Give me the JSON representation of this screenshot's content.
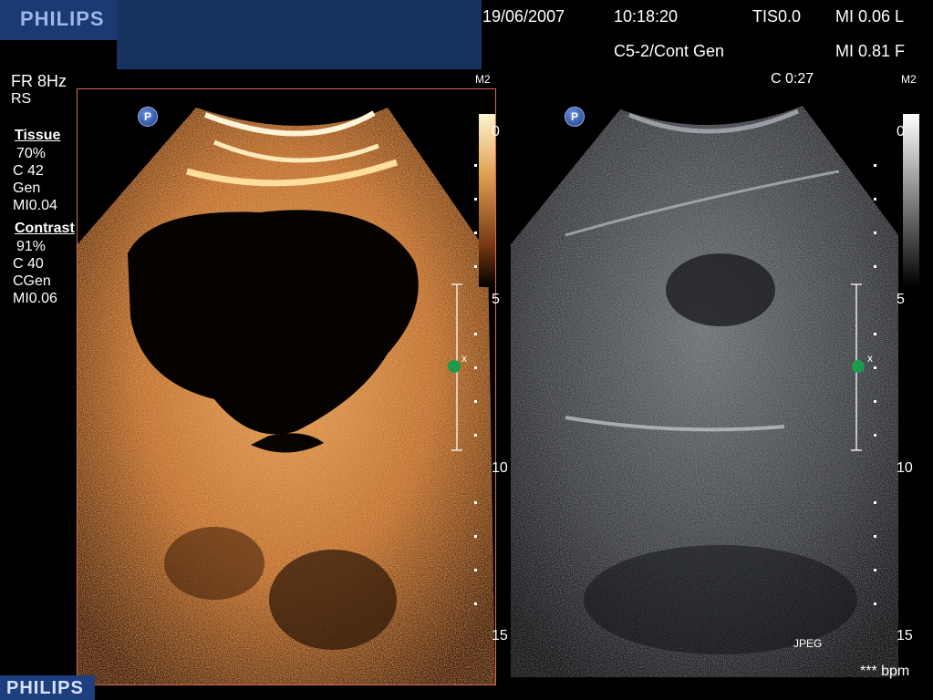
{
  "header": {
    "brand": "PHILIPS",
    "date": "19/06/2007",
    "time": "10:18:20",
    "tis": "TIS0.0",
    "mi_left": "MI 0.06 L",
    "probe": "C5-2/Cont Gen",
    "mi_right": "MI 0.81 F"
  },
  "left_panel": {
    "frame_rate": "FR 8Hz",
    "rs": "RS",
    "tissue_label": "Tissue",
    "tissue_pct": "70%",
    "tissue_c": "C 42",
    "tissue_mode": "Gen",
    "tissue_mi": "MI0.04",
    "contrast_label": "Contrast",
    "contrast_pct": "91%",
    "contrast_c": "C 40",
    "contrast_mode": "CGen",
    "contrast_mi": "MI0.06"
  },
  "contrast_view": {
    "map_label": "M2",
    "badge": "P",
    "scale_top": "0",
    "depth_marks": [
      "5",
      "10",
      "15"
    ],
    "focus_marker": "x"
  },
  "bmode_view": {
    "timer": "C 0:27",
    "map_label": "M2",
    "badge": "P",
    "scale_top": "0",
    "depth_marks": [
      "5",
      "10",
      "15"
    ],
    "focus_marker": "x",
    "format": "JPEG",
    "bpm": "*** bpm"
  },
  "footer": {
    "brand": "PHILIPS"
  },
  "colors": {
    "header_panel": "#17325f",
    "frame_border": "#d46a5a",
    "contrast_map": "#c87a3a",
    "focus_dot": "#1e9a4c"
  }
}
